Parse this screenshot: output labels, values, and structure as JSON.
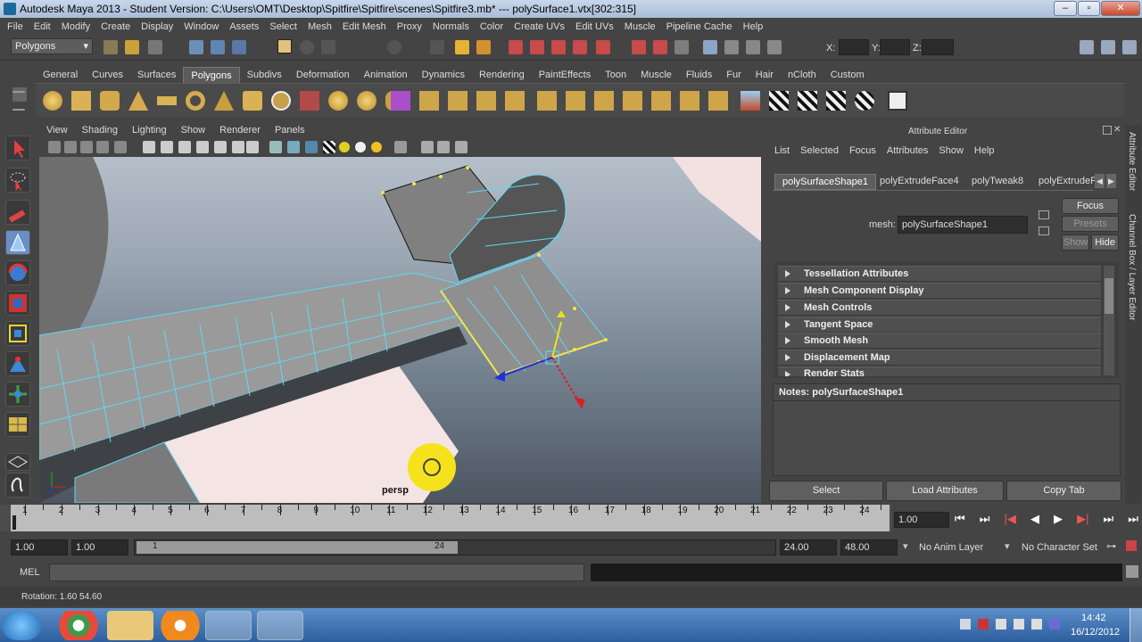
{
  "title_bar": {
    "text": "Autodesk Maya 2013 - Student Version: C:\\Users\\OMT\\Desktop\\Spitfire\\Spitfire\\scenes\\Spitfire3.mb*   ---   polySurface1.vtx[302:315]"
  },
  "menu": [
    "File",
    "Edit",
    "Modify",
    "Create",
    "Display",
    "Window",
    "Assets",
    "Select",
    "Mesh",
    "Edit Mesh",
    "Proxy",
    "Normals",
    "Color",
    "Create UVs",
    "Edit UVs",
    "Muscle",
    "Pipeline Cache",
    "Help"
  ],
  "status_line": {
    "mode": "Polygons",
    "x_label": "X:",
    "y_label": "Y:",
    "z_label": "Z:"
  },
  "shelf_tabs": [
    "General",
    "Curves",
    "Surfaces",
    "Polygons",
    "Subdivs",
    "Deformation",
    "Animation",
    "Dynamics",
    "Rendering",
    "PaintEffects",
    "Toon",
    "Muscle",
    "Fluids",
    "Fur",
    "Hair",
    "nCloth",
    "Custom"
  ],
  "active_shelf_tab": "Polygons",
  "viewport": {
    "menu": [
      "View",
      "Shading",
      "Lighting",
      "Show",
      "Renderer",
      "Panels"
    ],
    "camera_label": "persp"
  },
  "attribute_editor": {
    "title": "Attribute Editor",
    "menu": [
      "List",
      "Selected",
      "Focus",
      "Attributes",
      "Show",
      "Help"
    ],
    "tabs": [
      "polySurfaceShape1",
      "polyExtrudeFace4",
      "polyTweak8",
      "polyExtrudeF"
    ],
    "mesh_label": "mesh:",
    "mesh_value": "polySurfaceShape1",
    "focus_btn": "Focus",
    "presets_btn": "Presets",
    "show_btn": "Show",
    "hide_btn": "Hide",
    "sections": [
      "Tessellation Attributes",
      "Mesh Component Display",
      "Mesh Controls",
      "Tangent Space",
      "Smooth Mesh",
      "Displacement Map",
      "Render Stats"
    ],
    "notes": "Notes:  polySurfaceShape1",
    "select_btn": "Select",
    "load_btn": "Load Attributes",
    "copy_btn": "Copy Tab",
    "side_tab_1": "Attribute Editor",
    "side_tab_2": "Channel Box / Layer Editor"
  },
  "time_slider": {
    "ticks": [
      "1",
      "2",
      "3",
      "4",
      "5",
      "6",
      "7",
      "8",
      "9",
      "10",
      "11",
      "12",
      "13",
      "14",
      "15",
      "16",
      "17",
      "18",
      "19",
      "20",
      "21",
      "22",
      "23",
      "24"
    ],
    "current_time": "1.00"
  },
  "range_slider": {
    "start": "1.00",
    "playback_start": "1.00",
    "range_start": "1",
    "range_end": "24",
    "playback_end": "24.00",
    "end": "48.00",
    "anim_layer": "No Anim Layer",
    "character_set": "No Character Set"
  },
  "command_line": {
    "label": "MEL"
  },
  "help_line": {
    "text": "Rotation:  1.60     54.60"
  },
  "taskbar": {
    "time": "14:42",
    "date": "16/12/2012"
  }
}
